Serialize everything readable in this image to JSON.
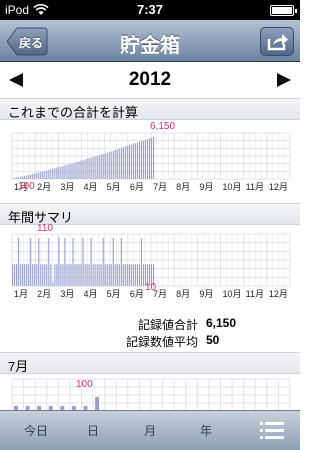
{
  "status": {
    "carrier": "iPod",
    "time": "7:37"
  },
  "nav": {
    "back_label": "戻る",
    "title": "貯金箱"
  },
  "year": {
    "value": "2012"
  },
  "cumulative": {
    "header": "これまでの合計を計算",
    "max_label": "6,150",
    "min_label": "100"
  },
  "annual": {
    "header": "年間サマリ",
    "max_label": "110",
    "min_label": "10"
  },
  "summary": {
    "total_label": "記録値合計",
    "total_value": "6,150",
    "avg_label": "記録数値平均",
    "avg_value": "50"
  },
  "monthly": {
    "header": "7月",
    "max_label": "100"
  },
  "months": [
    "1月",
    "2月",
    "3月",
    "4月",
    "5月",
    "6月",
    "7月",
    "8月",
    "9月",
    "10月",
    "11月",
    "12月"
  ],
  "tabs": {
    "today": "今日",
    "day": "日",
    "month": "月",
    "year": "年"
  },
  "colors": {
    "bar": "#9aa0cc",
    "accent": "#d6336c",
    "grid": "#dfe3ea"
  },
  "chart_data": [
    {
      "type": "bar",
      "title": "これまでの合計を計算",
      "x_categories": [
        "1月",
        "2月",
        "3月",
        "4月",
        "5月",
        "6月",
        "7月",
        "8月",
        "9月",
        "10月",
        "11月",
        "12月"
      ],
      "ylim": [
        0,
        6150
      ],
      "annotations": [
        "6,150",
        "100"
      ],
      "values": [
        100,
        150,
        200,
        260,
        320,
        390,
        460,
        520,
        590,
        660,
        730,
        800,
        880,
        950,
        1020,
        1100,
        1180,
        1260,
        1340,
        1420,
        1500,
        1580,
        1660,
        1740,
        1820,
        1900,
        1980,
        2060,
        2140,
        2230,
        2320,
        2410,
        2500,
        2590,
        2680,
        2770,
        2860,
        2950,
        3040,
        3130,
        3220,
        3310,
        3400,
        3490,
        3580,
        3670,
        3760,
        3850,
        3950,
        4050,
        4150,
        4250,
        4350,
        4450,
        4550,
        4650,
        4750,
        4850,
        4950,
        5050,
        5150,
        5250,
        5350,
        5450,
        5550,
        5650,
        5750,
        5850,
        5950,
        6050,
        6150
      ]
    },
    {
      "type": "bar",
      "title": "年間サマリ",
      "x_categories": [
        "1月",
        "2月",
        "3月",
        "4月",
        "5月",
        "6月",
        "7月",
        "8月",
        "9月",
        "10月",
        "11月",
        "12月"
      ],
      "ylim": [
        0,
        110
      ],
      "annotations": [
        "110",
        "10"
      ],
      "values": [
        50,
        50,
        50,
        110,
        50,
        50,
        50,
        50,
        50,
        110,
        50,
        50,
        50,
        110,
        50,
        50,
        50,
        50,
        110,
        50,
        10,
        50,
        50,
        110,
        50,
        50,
        110,
        50,
        50,
        50,
        110,
        50,
        50,
        50,
        50,
        110,
        50,
        50,
        50,
        110,
        50,
        50,
        50,
        50,
        50,
        110,
        50,
        50,
        50,
        50,
        110,
        50,
        50,
        50,
        110,
        50,
        50,
        50,
        50,
        50,
        50,
        50,
        50,
        50,
        110,
        50,
        50,
        50,
        50,
        50,
        50
      ]
    },
    {
      "type": "bar",
      "title": "7月",
      "ylim": [
        0,
        100
      ],
      "annotations": [
        "100"
      ],
      "values": [
        50,
        50,
        50,
        50,
        50,
        50,
        50,
        100
      ]
    }
  ]
}
